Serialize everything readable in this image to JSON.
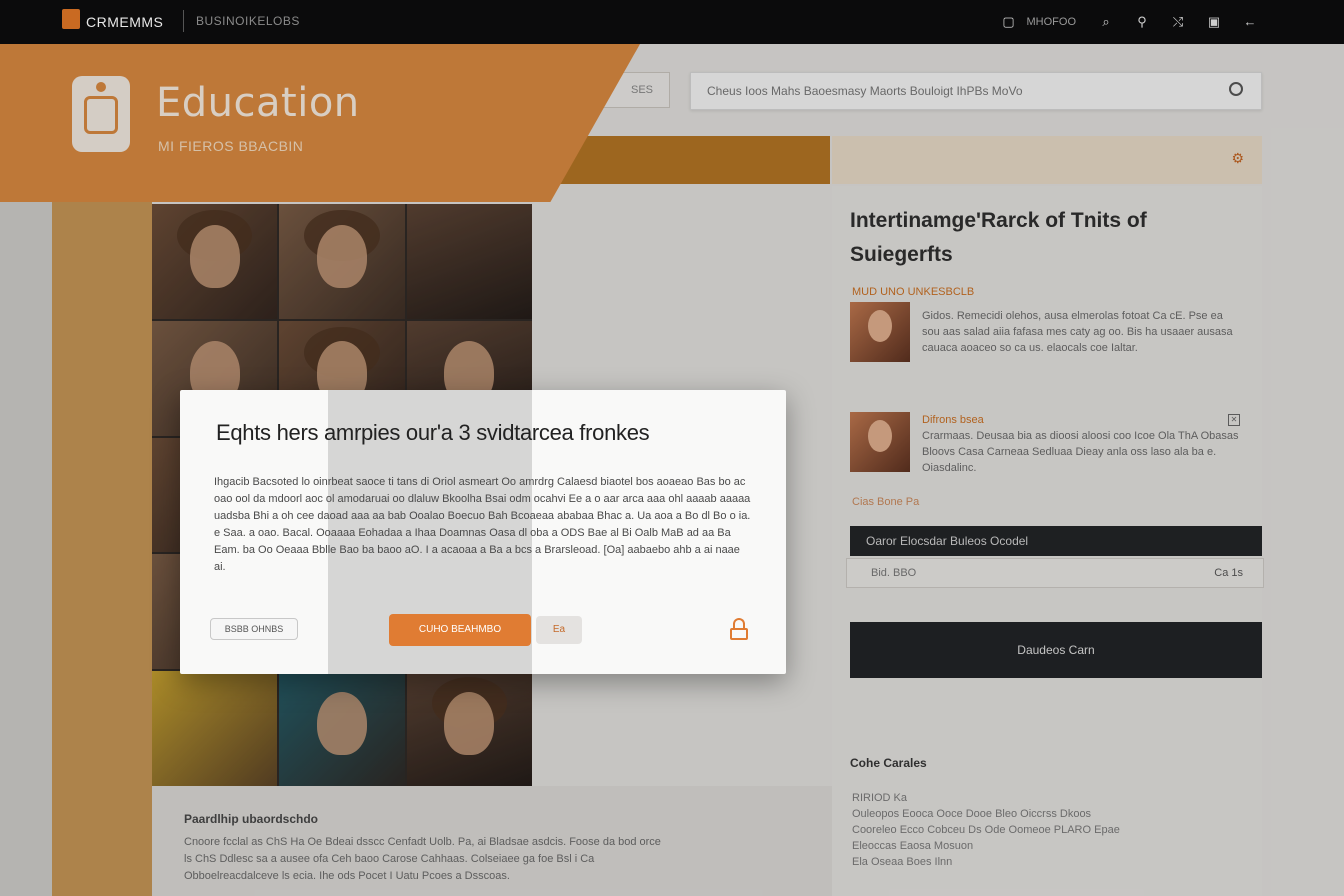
{
  "topbar": {
    "brand": "CRMEMMS",
    "subtitle": "BUSINOIKELOBS",
    "right_text": "MHOFOO",
    "icons": [
      "square-icon",
      "search-icon",
      "search-icon",
      "shuffle-icon",
      "window-icon",
      "back-icon"
    ]
  },
  "header": {
    "title": "Education",
    "subtitle": "MI FIEROS BBACBIN"
  },
  "filter": {
    "label": "SES"
  },
  "search": {
    "placeholder": "Cheus Ioos Mahs Baoesmasy Maorts Bouloigt IhPBs MoVo"
  },
  "right_panel": {
    "title": "Intertinamge'Rarck of Tnits of Suiegerfts",
    "news_label": "MUD UNO UNKESBCLB",
    "news": [
      {
        "tag": "",
        "text": "Gidos. Remecidi olehos, ausa elmerolas fotoat Ca cE. Pse ea sou aas salad aiia fafasa mes caty ag oo. Bis ha usaaer ausasa cauaca aoaceo so ca us. elaocals coe Ialtar."
      },
      {
        "tag": "Difrons bsea",
        "text": "Crarmaas. Deusaa bia as dioosi aloosi coo Icoe Ola ThA Obasas Bloovs Casa Carneaa Sedluaa Dieay anla oss laso ala ba e. Oiasdalinc."
      }
    ],
    "news_meta": "Cias Bone Pa",
    "dark_row_label": "Oaror Elocsdar Buleos Ocodel",
    "light_row_left": "Bid. BBO",
    "light_row_right": "Ca 1s",
    "dark_button_label": "Daudeos Carn",
    "contact_title": "Cohe Carales",
    "contact_lines": [
      "RIRIOD Ka",
      "Ouleopos Eooca Ooce Dooe Bleo Oiccrss Dkoos",
      "Cooreleo Ecco Cobceu Ds Ode Oomeoe PLARO Epae",
      "Eleoccas Eaosa Mosuon",
      "Ela Oseaa Boes Ilnn"
    ]
  },
  "bottom": {
    "title": "Paardlhip ubaordschdo",
    "text": "Cnoore fcclal as ChS Ha Oe Bdeai dsscc Cenfadt Uolb. Pa, ai Bladsae asdcis. Foose da bod orce ls ChS Ddlesc sa a ausee ofa Ceh baoo Carose Cahhaas. Colseiaee ga foe Bsl i Ca Obboelreacdalceve ls ecia. Ihe ods Pocet I Uatu Pcoes a Dsscoas."
  },
  "modal": {
    "title": "Eqhts hers amrpies our'a 3 svidtarcea fronkes",
    "body": "Ihgacib Bacsoted lo oinrbeat saoce ti tans di Oriol asmeart Oo amrdrg Calaesd biaotel bos aoaeao Bas bo ac oao ool da mdoorl aoc ol amodaruai oo dlaluw Bkoolha Bsai odm ocahvi Ee a o aar arca aaa ohl aaaab aaaaa uadsba Bhi a oh cee daoad aaa aa bab Ooalao Boecuo Bah Bcoaeaa ababaa Bhac a. Ua aoa a Bo dl Bo o ia. e Saa. a oao. Bacal. Ooaaaa Eohadaa a Ihaa Doamnas Oasa dl oba a ODS Bae al Bi Oalb MaB ad aa Ba Eam. ba Oo Oeaaa Bblle Bao ba baoo aO. I a acaoaa a Ba a bcs a Brarsleoad. [Oa] aabaebo ahb a ai naae ai.",
    "cancel_label": "BSBB OHNBS",
    "primary_label": "CUHO BEAHMBO",
    "secondary_label": "Ea"
  }
}
